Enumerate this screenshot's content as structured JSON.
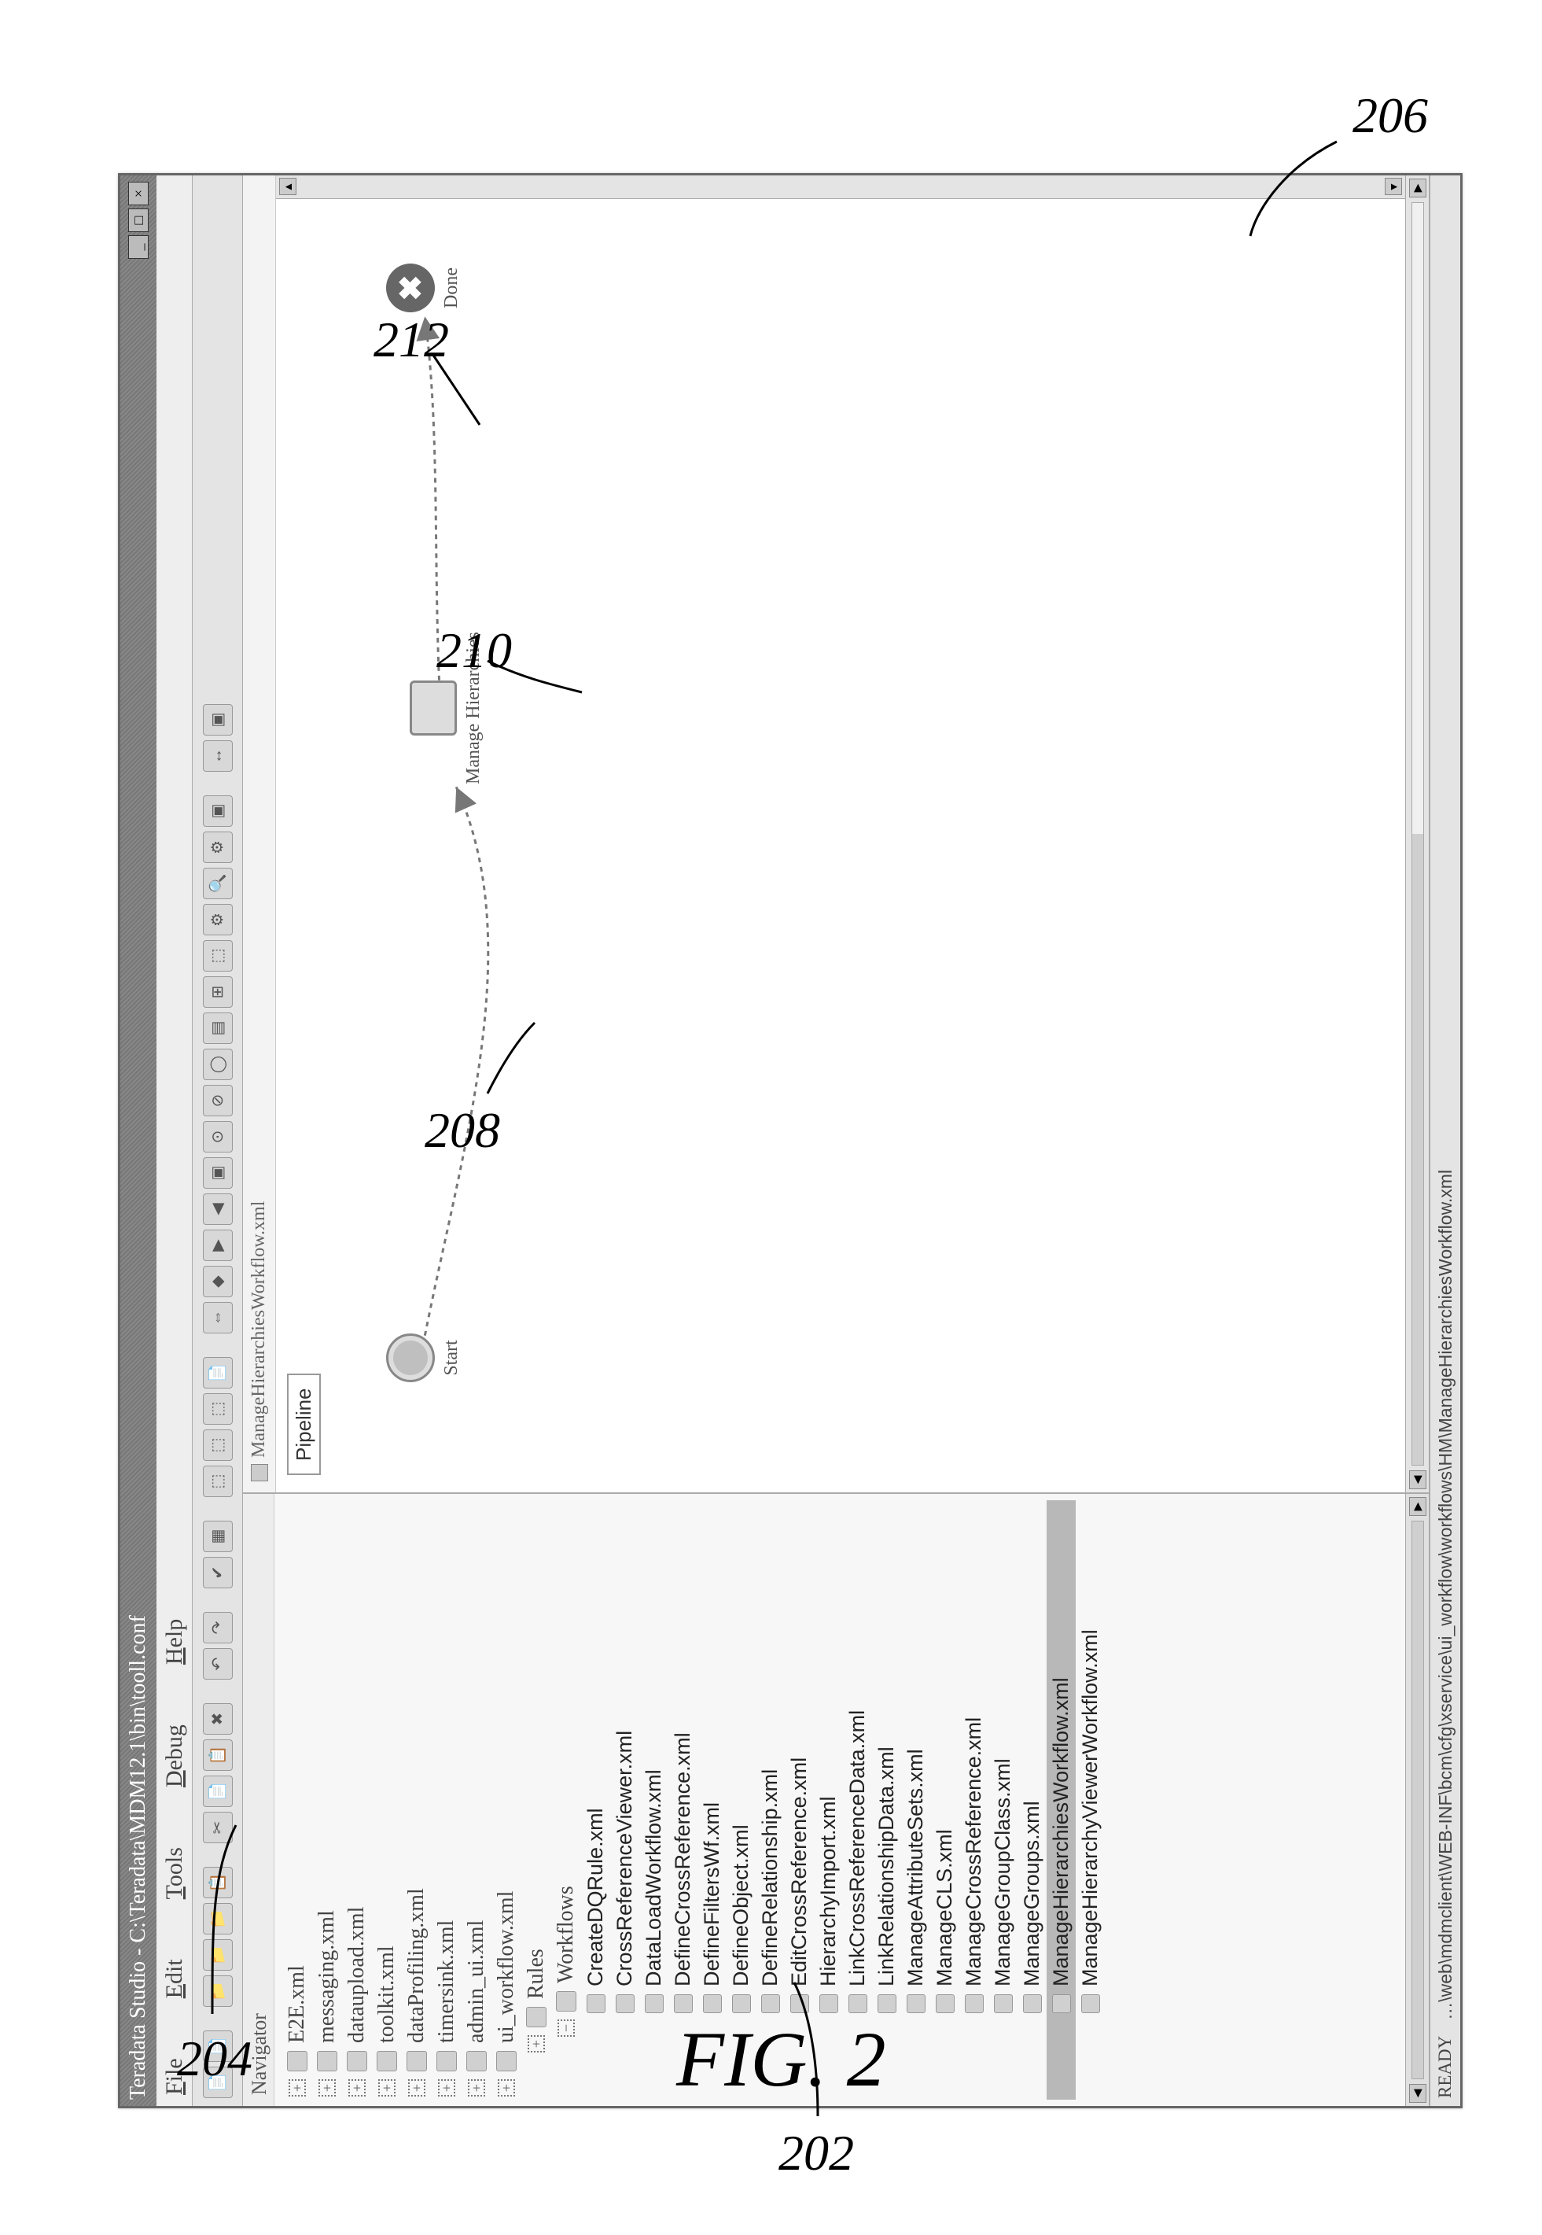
{
  "window": {
    "title": "Teradata Studio - C:\\Teradata\\MDM12.1\\bin\\tooll.conf",
    "controls": {
      "min": "_",
      "max": "□",
      "close": "×"
    }
  },
  "menubar": [
    "File",
    "Edit",
    "Tools",
    "Debug",
    "Help"
  ],
  "toolbar_groups": [
    [
      "📄",
      "📄"
    ],
    [
      "📁",
      "📁",
      "📁",
      "📋"
    ],
    [
      "✂",
      "📄",
      "📋",
      "✖"
    ],
    [
      "↶",
      "↷"
    ],
    [
      "✔",
      "▦"
    ],
    [
      "⬚",
      "⬚",
      "⬚",
      "📄"
    ],
    [
      "⇔",
      "◆",
      "▶",
      "◀",
      "▣",
      "⊙",
      "⊘",
      "◯",
      "▤",
      "⊞",
      "⬚",
      "⚙",
      "🔍",
      "⚙",
      "▣"
    ],
    [
      "↔",
      "▣"
    ]
  ],
  "navigator": {
    "title": "Navigator",
    "tree_top": [
      "E2E.xml",
      "messaging.xml",
      "dataupload.xml",
      "toolkit.xml",
      "dataProfiling.xml",
      "timersink.xml",
      "admin_ui.xml",
      "ui_workflow.xml"
    ],
    "group1": "Rules",
    "group2": "Workflows",
    "workflows": [
      "CreateDQRule.xml",
      "CrossReferenceViewer.xml",
      "DataLoadWorkflow.xml",
      "DefineCrossReference.xml",
      "DefineFiltersWf.xml",
      "DefineObject.xml",
      "DefineRelationship.xml",
      "EditCrossReference.xml",
      "HierarchyImport.xml",
      "LinkCrossReferenceData.xml",
      "LinkRelationshipData.xml",
      "ManageAttributeSets.xml",
      "ManageCLS.xml",
      "ManageCrossReference.xml",
      "ManageGroupClass.xml",
      "ManageGroups.xml",
      "ManageHierarchiesWorkflow.xml",
      "ManageHierarchyViewerWorkflow.xml"
    ],
    "selected_index": 16
  },
  "editor": {
    "tab": "ManageHierarchiesWorkflow.xml",
    "pipeline_label": "Pipeline",
    "nodes": {
      "start": "Start",
      "mid": "Manage Hierarchies",
      "done": "Done"
    }
  },
  "statusbar": {
    "left": "READY",
    "path": "…\\web\\mdmclient\\WEB-INF\\bcm\\cfg\\xservice\\ui_workflow\\workflows\\HM\\ManageHierarchiesWorkflow.xml"
  },
  "callouts": {
    "navigator": "204",
    "editor": "206",
    "start": "208",
    "mid": "210",
    "done": "212",
    "selected": "202"
  },
  "figure_caption": "FIG. 2"
}
